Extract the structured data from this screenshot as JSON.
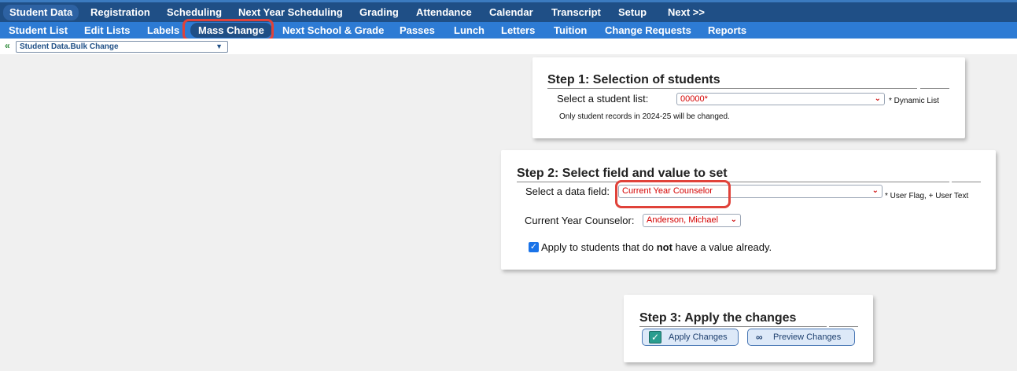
{
  "top_nav": {
    "items": [
      "Student Data",
      "Registration",
      "Scheduling",
      "Next Year Scheduling",
      "Grading",
      "Attendance",
      "Calendar",
      "Transcript",
      "Setup",
      "Next >>"
    ],
    "active": "Student Data"
  },
  "sub_nav": {
    "items": [
      "Student List",
      "Edit Lists",
      "Labels",
      "Mass Change",
      "Next School & Grade",
      "Passes",
      "Lunch",
      "Letters",
      "Tuition",
      "Change Requests",
      "Reports"
    ],
    "active": "Mass Change"
  },
  "toolbar": {
    "back_icon": "«",
    "page_select_value": "Student Data.Bulk Change"
  },
  "step1": {
    "title": "Step 1: Selection of students",
    "select_label": "Select a student list:",
    "select_value": "00000*",
    "note": "* Dynamic List",
    "info": "Only student records in 2024-25 will be changed."
  },
  "step2": {
    "title": "Step 2: Select field and value to set",
    "field_label": "Select a data field:",
    "field_value": "Current Year Counselor",
    "field_note": "* User Flag, + User Text",
    "value_label": "Current Year Counselor:",
    "value_value": "Anderson, Michael",
    "apply_pre": "Apply to students that do ",
    "apply_bold": "not",
    "apply_post": " have a value already.",
    "apply_checked": true
  },
  "step3": {
    "title": "Step 3: Apply the changes",
    "apply_button": "Apply Changes",
    "preview_button": "Preview Changes"
  },
  "colors": {
    "top_nav_bg": "#1f4f86",
    "sub_nav_bg": "#2d7bd4",
    "highlight": "#e0423a",
    "select_text": "#d40000"
  },
  "icons": {
    "back": "double-chevron-left-icon",
    "dropdown": "chevron-down-icon",
    "apply": "check-icon",
    "preview": "binoculars-icon"
  }
}
